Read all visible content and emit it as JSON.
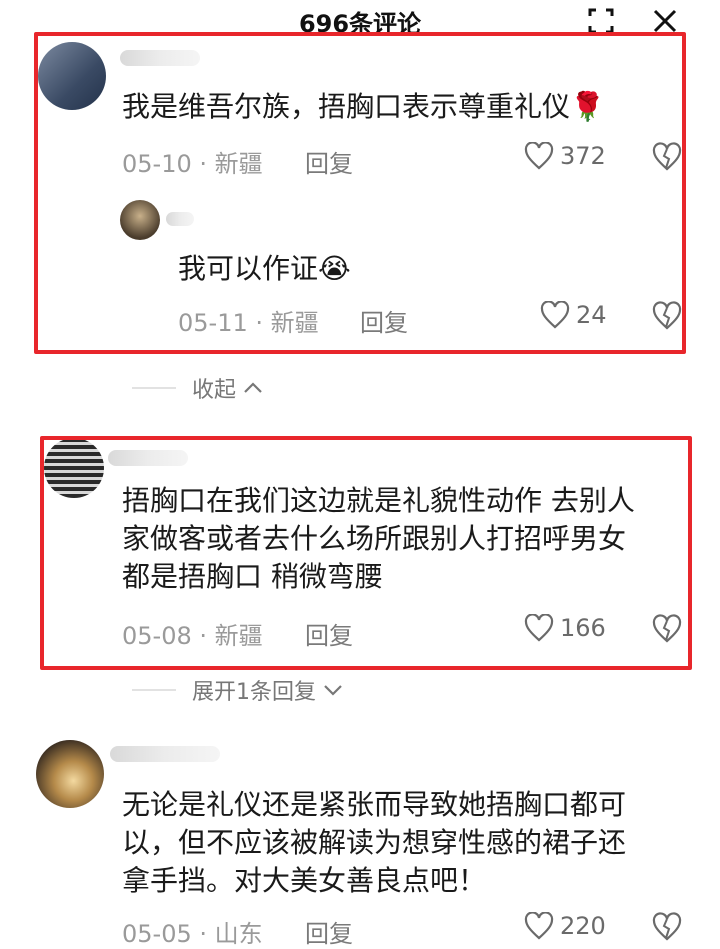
{
  "header": {
    "title": "696条评论"
  },
  "comments": [
    {
      "text": "我是维吾尔族，捂胸口表示尊重礼仪🌹",
      "date": "05-10",
      "sep": "·",
      "location": "新疆",
      "reply_label": "回复",
      "likes": "372",
      "replies": [
        {
          "text": "我可以作证😭",
          "date": "05-11",
          "sep": "·",
          "location": "新疆",
          "reply_label": "回复",
          "likes": "24"
        }
      ],
      "toggle_label": "收起"
    },
    {
      "text_lines": [
        "捂胸口在我们这边就是礼貌性动作 去别人",
        "家做客或者去什么场所跟别人打招呼男女",
        "都是捂胸口 稍微弯腰"
      ],
      "date": "05-08",
      "sep": "·",
      "location": "新疆",
      "reply_label": "回复",
      "likes": "166",
      "toggle_label": "展开1条回复"
    },
    {
      "text_lines": [
        "无论是礼仪还是紧张而导致她捂胸口都可",
        "以，但不应该被解读为想穿性感的裙子还",
        "拿手挡。对大美女善良点吧！"
      ],
      "date": "05-05",
      "sep": "·",
      "location": "山东",
      "reply_label": "回复",
      "likes": "220"
    }
  ],
  "colors": {
    "highlight": "#e8262b",
    "muted": "#9a9a9a"
  }
}
